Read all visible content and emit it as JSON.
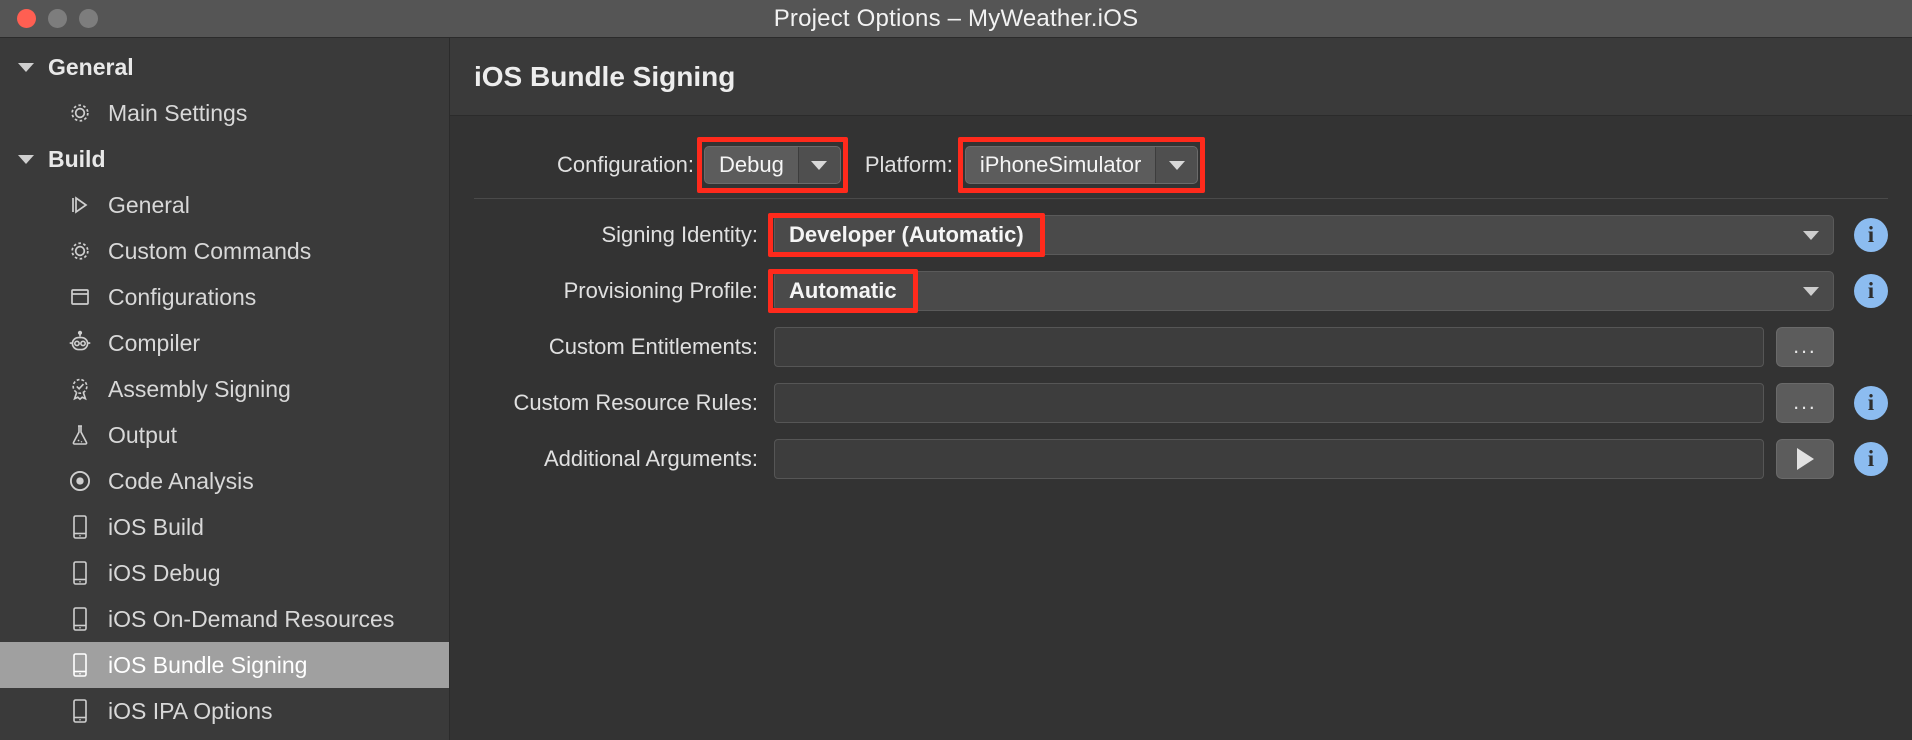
{
  "window": {
    "title": "Project Options – MyWeather.iOS",
    "controls": [
      "close",
      "minimize",
      "zoom"
    ],
    "accent_red": "#ff2a1c",
    "info_blue": "#8cbcf0",
    "selection_gray": "#a0a0a0"
  },
  "sidebar": {
    "groups": [
      {
        "label": "General",
        "expanded": true,
        "items": [
          {
            "label": "Main Settings",
            "icon": "gear-icon",
            "selected": false
          }
        ]
      },
      {
        "label": "Build",
        "expanded": true,
        "items": [
          {
            "label": "General",
            "icon": "play-outline-icon",
            "selected": false
          },
          {
            "label": "Custom Commands",
            "icon": "gear-icon",
            "selected": false
          },
          {
            "label": "Configurations",
            "icon": "square-icon",
            "selected": false
          },
          {
            "label": "Compiler",
            "icon": "robot-icon",
            "selected": false
          },
          {
            "label": "Assembly Signing",
            "icon": "seal-check-icon",
            "selected": false
          },
          {
            "label": "Output",
            "icon": "flask-icon",
            "selected": false
          },
          {
            "label": "Code Analysis",
            "icon": "radio-dot-icon",
            "selected": false
          },
          {
            "label": "iOS Build",
            "icon": "phone-icon",
            "selected": false
          },
          {
            "label": "iOS Debug",
            "icon": "phone-icon",
            "selected": false
          },
          {
            "label": "iOS On-Demand Resources",
            "icon": "phone-icon",
            "selected": false
          },
          {
            "label": "iOS Bundle Signing",
            "icon": "phone-icon",
            "selected": true
          },
          {
            "label": "iOS IPA Options",
            "icon": "phone-icon",
            "selected": false
          }
        ]
      }
    ]
  },
  "main": {
    "title": "iOS Bundle Signing",
    "configuration": {
      "label": "Configuration:",
      "value": "Debug",
      "highlighted": true
    },
    "platform": {
      "label": "Platform:",
      "value": "iPhoneSimulator",
      "highlighted": true
    },
    "fields": [
      {
        "label": "Signing Identity:",
        "value": "Developer (Automatic)",
        "type": "select",
        "highlighted": true,
        "has_info": true,
        "button": null
      },
      {
        "label": "Provisioning Profile:",
        "value": "Automatic",
        "type": "select",
        "highlighted": true,
        "has_info": true,
        "button": null
      },
      {
        "label": "Custom Entitlements:",
        "value": "",
        "type": "text",
        "highlighted": false,
        "has_info": false,
        "button": "..."
      },
      {
        "label": "Custom Resource Rules:",
        "value": "",
        "type": "text",
        "highlighted": false,
        "has_info": true,
        "button": "..."
      },
      {
        "label": "Additional Arguments:",
        "value": "",
        "type": "text",
        "highlighted": false,
        "has_info": true,
        "button": "play"
      }
    ]
  }
}
